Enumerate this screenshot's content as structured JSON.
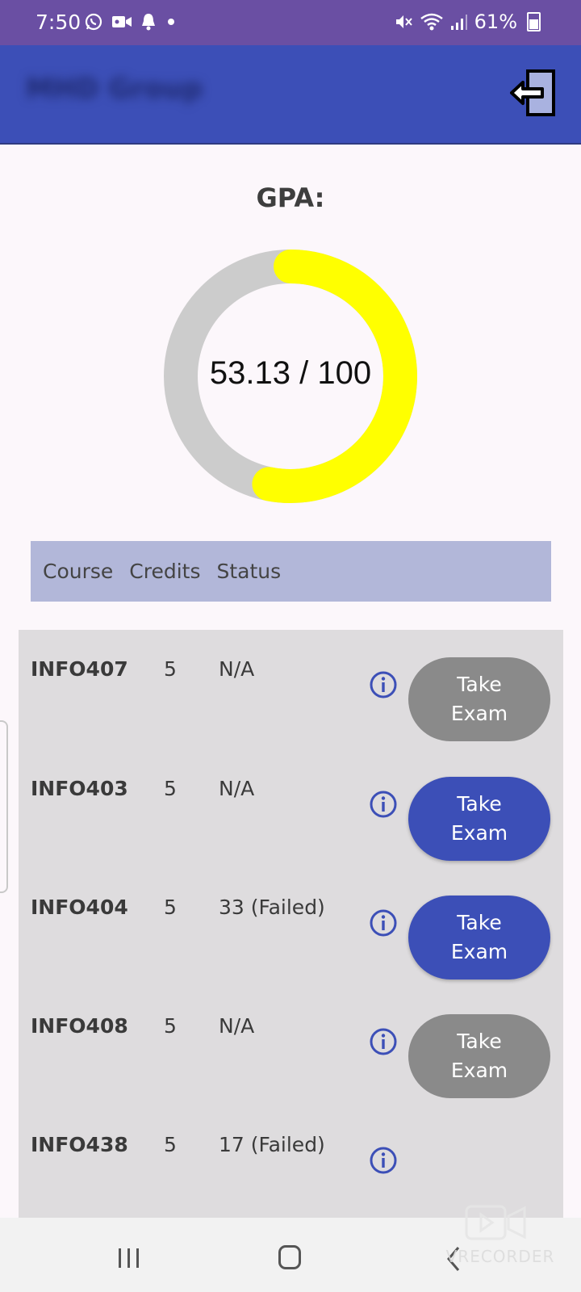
{
  "status_bar": {
    "time": "7:50",
    "battery": "61%",
    "icons_left": [
      "whatsapp-icon",
      "video-icon",
      "bell-icon",
      "dot-icon"
    ],
    "icons_right": [
      "mute-icon",
      "wifi-icon",
      "signal-icon",
      "battery-icon"
    ]
  },
  "app_bar": {
    "title": "MHD Group",
    "logout_icon": "logout-icon",
    "color": "#3c4fb7"
  },
  "gpa": {
    "label": "GPA:",
    "display": "53.13 / 100",
    "value": 53.13,
    "max": 100,
    "gauge_color": "#ffff00",
    "track_color": "#cccccc"
  },
  "table": {
    "headers": [
      "Course",
      "Credits",
      "Status"
    ]
  },
  "courses": [
    {
      "code": "INFO407",
      "credits": "5",
      "status": "N/A",
      "button": "Take\nExam",
      "button_enabled": false
    },
    {
      "code": "INFO403",
      "credits": "5",
      "status": "N/A",
      "button": "Take\nExam",
      "button_enabled": true
    },
    {
      "code": "INFO404",
      "credits": "5",
      "status": "33 (Failed)",
      "button": "Take\nExam",
      "button_enabled": true
    },
    {
      "code": "INFO408",
      "credits": "5",
      "status": "N/A",
      "button": "Take\nExam",
      "button_enabled": false
    },
    {
      "code": "INFO438",
      "credits": "5",
      "status": "17 (Failed)",
      "button": "",
      "button_enabled": false
    }
  ],
  "nav": {
    "icons": [
      "recent-apps-icon",
      "home-icon",
      "back-icon"
    ]
  },
  "watermark": {
    "text": "VRECORDER"
  }
}
